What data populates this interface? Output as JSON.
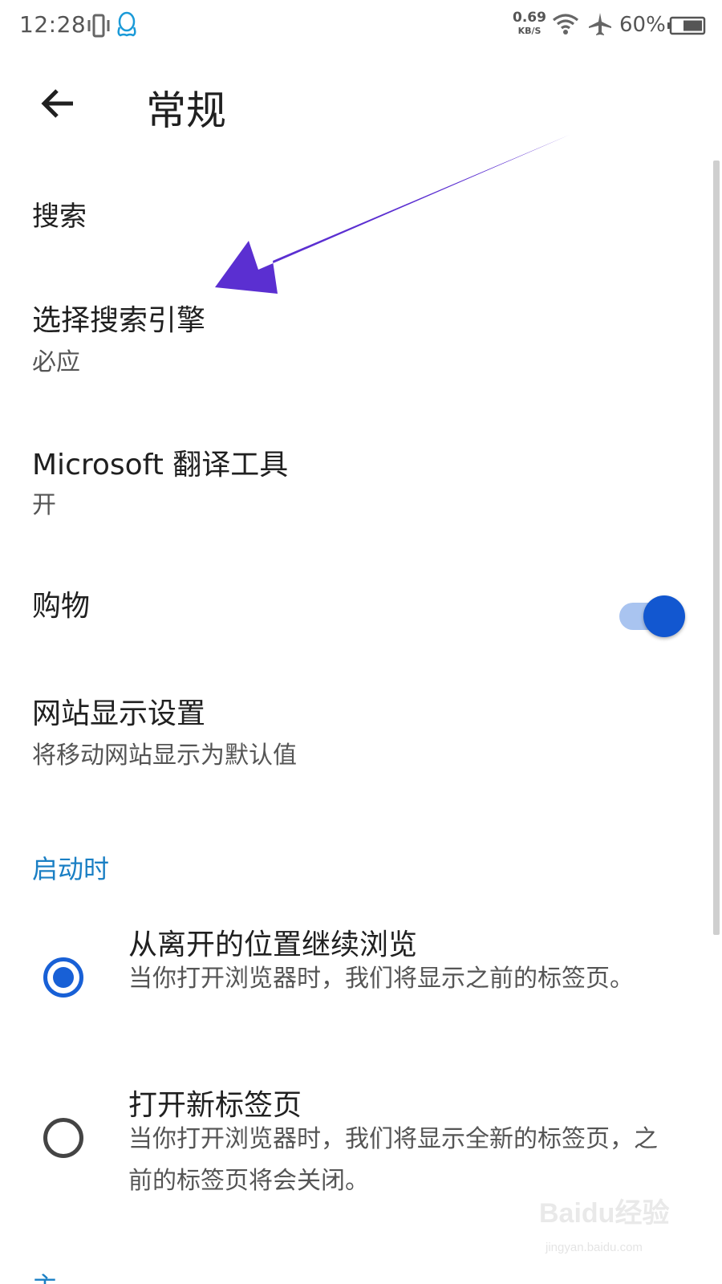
{
  "status_bar": {
    "time": "12:28",
    "net_speed_value": "0.69",
    "net_speed_unit": "KB/S",
    "battery_percent": "60%",
    "icons": [
      "vibrate-icon",
      "qq-icon",
      "wifi-icon",
      "airplane-icon",
      "battery-icon"
    ]
  },
  "app_bar": {
    "title": "常规",
    "back_icon": "arrow-left-icon"
  },
  "settings": {
    "search_heading": "搜索",
    "search_engine": {
      "title": "选择搜索引擎",
      "value": "必应"
    },
    "translator": {
      "title": "Microsoft 翻译工具",
      "value": "开"
    },
    "shopping": {
      "title": "购物",
      "enabled": true
    },
    "site_display": {
      "title": "网站显示设置",
      "value": "将移动网站显示为默认值"
    }
  },
  "startup": {
    "heading": "启动时",
    "options": [
      {
        "title": "从离开的位置继续浏览",
        "description": "当你打开浏览器时，我们将显示之前的标签页。",
        "selected": true
      },
      {
        "title": "打开新标签页",
        "description": "当你打开浏览器时，我们将显示全新的标签页，之前的标签页将会关闭。",
        "selected": false
      }
    ],
    "next_heading_partial": "主页"
  },
  "watermark": {
    "brand": "Baidu经验",
    "url": "jingyan.baidu.com"
  },
  "colors": {
    "accent_blue": "#1860d6",
    "section_blue": "#1a7fc4",
    "toggle_track": "#a9c4f0",
    "toggle_thumb": "#1257d0",
    "annotation_arrow": "#5b2fd1"
  }
}
